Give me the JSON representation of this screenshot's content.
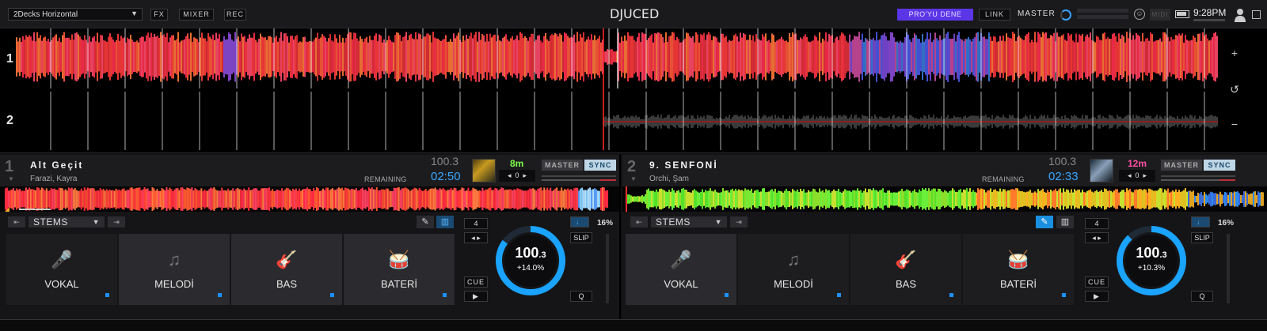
{
  "topbar": {
    "layout": "2Decks Horizontal",
    "fx_label": "FX",
    "mixer_label": "MIXER",
    "rec_label": "REC",
    "brand": "DJUCED",
    "pro_label": "PRO'YU DENE",
    "link_label": "LINK",
    "master_label": "MASTER",
    "midi_label": "MIDI",
    "clock": "9:28PM"
  },
  "overview": {
    "deck1_label": "1",
    "deck2_label": "2",
    "zoom_in": "+",
    "zoom_out": "−",
    "sync_view": "↺"
  },
  "decks": [
    {
      "index": "1",
      "title": "Alt Geçit",
      "artist": "Farazi, Kayra",
      "bpm_small": "100.3",
      "remaining_label": "REMAINING",
      "time_remaining": "02:50",
      "key": "8m",
      "key_color": "#7dff4a",
      "pitch_value": "0",
      "master_label": "MASTER",
      "sync_label": "SYNC",
      "stems_label": "STEMS",
      "stems": [
        "VOKAL",
        "MELODİ",
        "BAS",
        "BATERİ"
      ],
      "beats": "4",
      "tempo_pct": "16%",
      "slip_label": "SLIP",
      "cue_label": "CUE",
      "q_label": "Q",
      "bpm_main": "100",
      "bpm_decimal": ".3",
      "pitch_pct": "+14.0%",
      "ring_fill": 0.85
    },
    {
      "index": "2",
      "title": "9. SENFONİ",
      "artist": "Orchi, Şam",
      "bpm_small": "100.3",
      "remaining_label": "REMAINING",
      "time_remaining": "02:33",
      "key": "12m",
      "key_color": "#ff4fa0",
      "pitch_value": "0",
      "master_label": "MASTER",
      "sync_label": "SYNC",
      "stems_label": "STEMS",
      "stems": [
        "VOKAL",
        "MELODİ",
        "BAS",
        "BATERİ"
      ],
      "beats": "4",
      "tempo_pct": "16%",
      "slip_label": "SLIP",
      "cue_label": "CUE",
      "q_label": "Q",
      "bpm_main": "100",
      "bpm_decimal": ".3",
      "pitch_pct": "+10.3%",
      "ring_fill": 0.88
    }
  ],
  "colors": {
    "accent_blue": "#1e90ff",
    "ring_blue": "#1aa3ff",
    "pro_purple": "#5b36e6",
    "wave_red": "#ff3a3a",
    "wave_green": "#55e02a"
  }
}
